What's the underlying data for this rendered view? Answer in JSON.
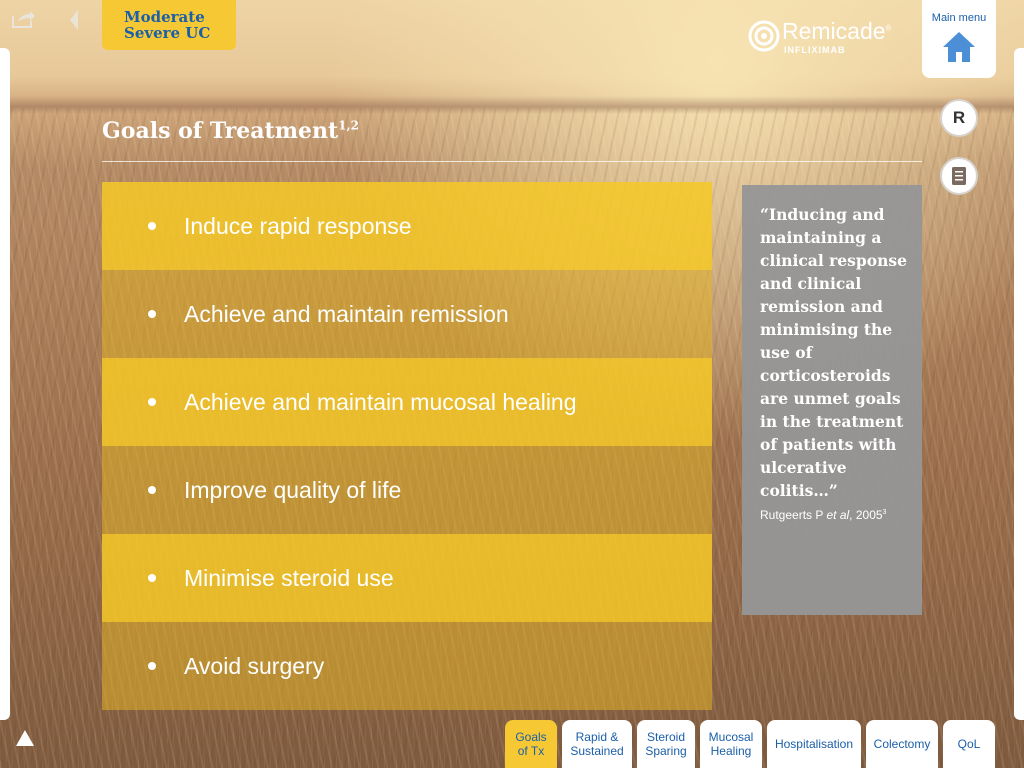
{
  "header": {
    "indication_line1": "Moderate",
    "indication_line2": "Severe UC",
    "brand_name": "Remicade",
    "brand_reg": "®",
    "brand_sub": "INFLIXIMAB",
    "main_menu_label": "Main menu",
    "r_button_label": "R"
  },
  "page": {
    "title": "Goals of Treatment",
    "title_refs": "1,2"
  },
  "goals": [
    "Induce rapid response",
    "Achieve and maintain remission",
    "Achieve and maintain mucosal healing",
    "Improve quality of life",
    "Minimise steroid use",
    "Avoid surgery"
  ],
  "quote": {
    "text": "“Inducing and maintaining a clinical response and clinical remission and minimising the use of corticosteroids are unmet goals in the treatment of patients with ulcerative colitis…”",
    "author": "Rutgeerts P ",
    "etal": "et al",
    "year": ", 2005",
    "ref": "3"
  },
  "tabs": [
    {
      "line1": "Goals",
      "line2": "of Tx",
      "active": true
    },
    {
      "line1": "Rapid &",
      "line2": "Sustained",
      "active": false
    },
    {
      "line1": "Steroid",
      "line2": "Sparing",
      "active": false
    },
    {
      "line1": "Mucosal",
      "line2": "Healing",
      "active": false
    },
    {
      "line1": "Hospitalisation",
      "line2": "",
      "active": false
    },
    {
      "line1": "Colectomy",
      "line2": "",
      "active": false
    },
    {
      "line1": "QoL",
      "line2": "",
      "active": false
    }
  ],
  "colors": {
    "accent_yellow": "#f6c834",
    "brand_blue": "#1b5fa8",
    "quote_grey": "#969696"
  },
  "icons": [
    "share-icon",
    "back-arrow-icon",
    "remicade-logo-icon",
    "home-icon",
    "document-icon",
    "up-arrow-icon"
  ]
}
